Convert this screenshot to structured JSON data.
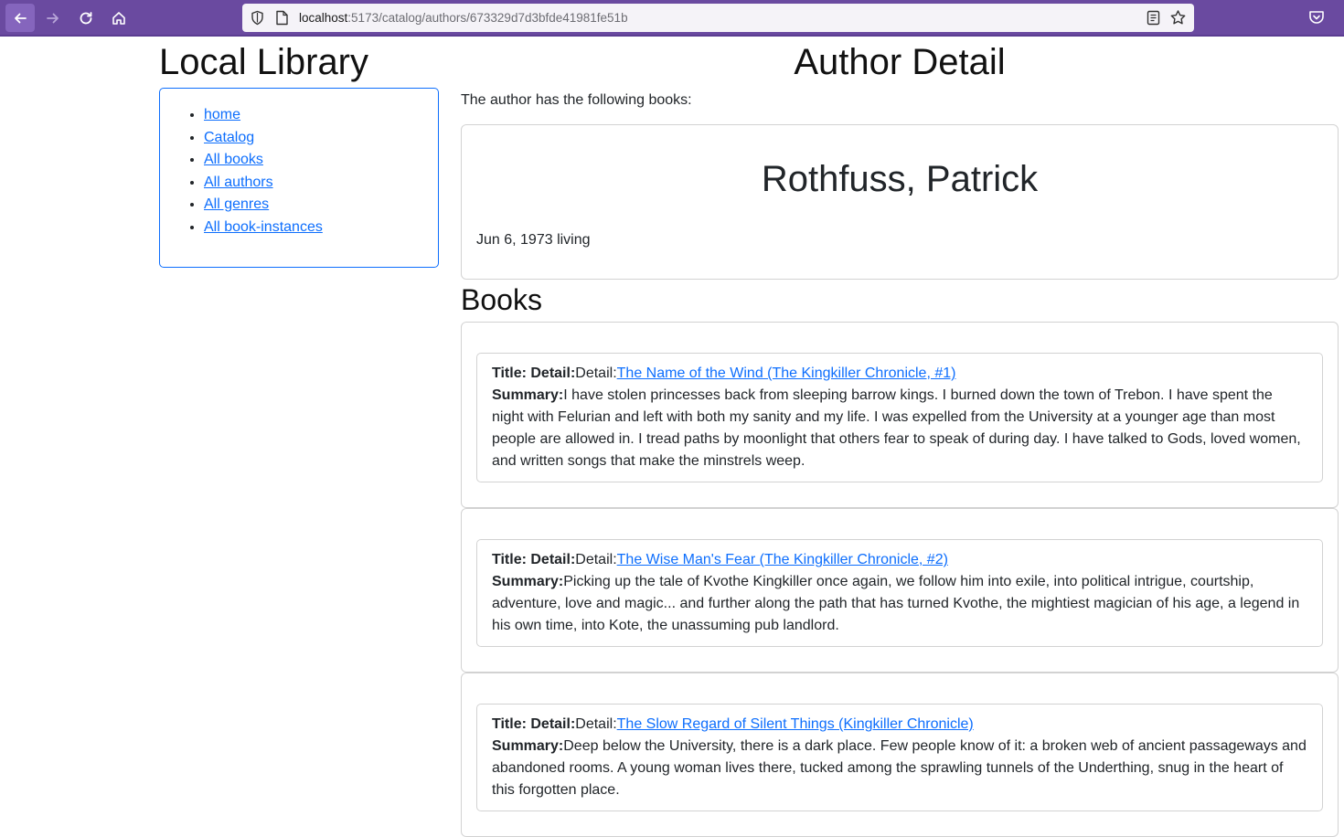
{
  "browser": {
    "url_host": "localhost",
    "url_path": ":5173/catalog/authors/673329d7d3bfde41981fe51b"
  },
  "sidebar": {
    "site_title": "Local Library",
    "links": [
      "home",
      "Catalog",
      "All books",
      "All authors",
      "All genres",
      "All book-instances"
    ]
  },
  "main": {
    "page_title": "Author Detail",
    "intro": "The author has the following books:",
    "author": {
      "name": "Rothfuss, Patrick",
      "dates": "Jun 6, 1973 living"
    },
    "books_heading": "Books",
    "title_label": "Title: Detail:",
    "detail_prefix": "Detail:",
    "summary_label": "Summary:",
    "books": [
      {
        "title": "The Name of the Wind (The Kingkiller Chronicle, #1)",
        "summary": "I have stolen princesses back from sleeping barrow kings. I burned down the town of Trebon. I have spent the night with Felurian and left with both my sanity and my life. I was expelled from the University at a younger age than most people are allowed in. I tread paths by moonlight that others fear to speak of during day. I have talked to Gods, loved women, and written songs that make the minstrels weep."
      },
      {
        "title": "The Wise Man's Fear (The Kingkiller Chronicle, #2)",
        "summary": "Picking up the tale of Kvothe Kingkiller once again, we follow him into exile, into political intrigue, courtship, adventure, love and magic... and further along the path that has turned Kvothe, the mightiest magician of his age, a legend in his own time, into Kote, the unassuming pub landlord."
      },
      {
        "title": "The Slow Regard of Silent Things (Kingkiller Chronicle)",
        "summary": "Deep below the University, there is a dark place. Few people know of it: a broken web of ancient passageways and abandoned rooms. A young woman lives there, tucked among the sprawling tunnels of the Underthing, snug in the heart of this forgotten place."
      }
    ]
  }
}
